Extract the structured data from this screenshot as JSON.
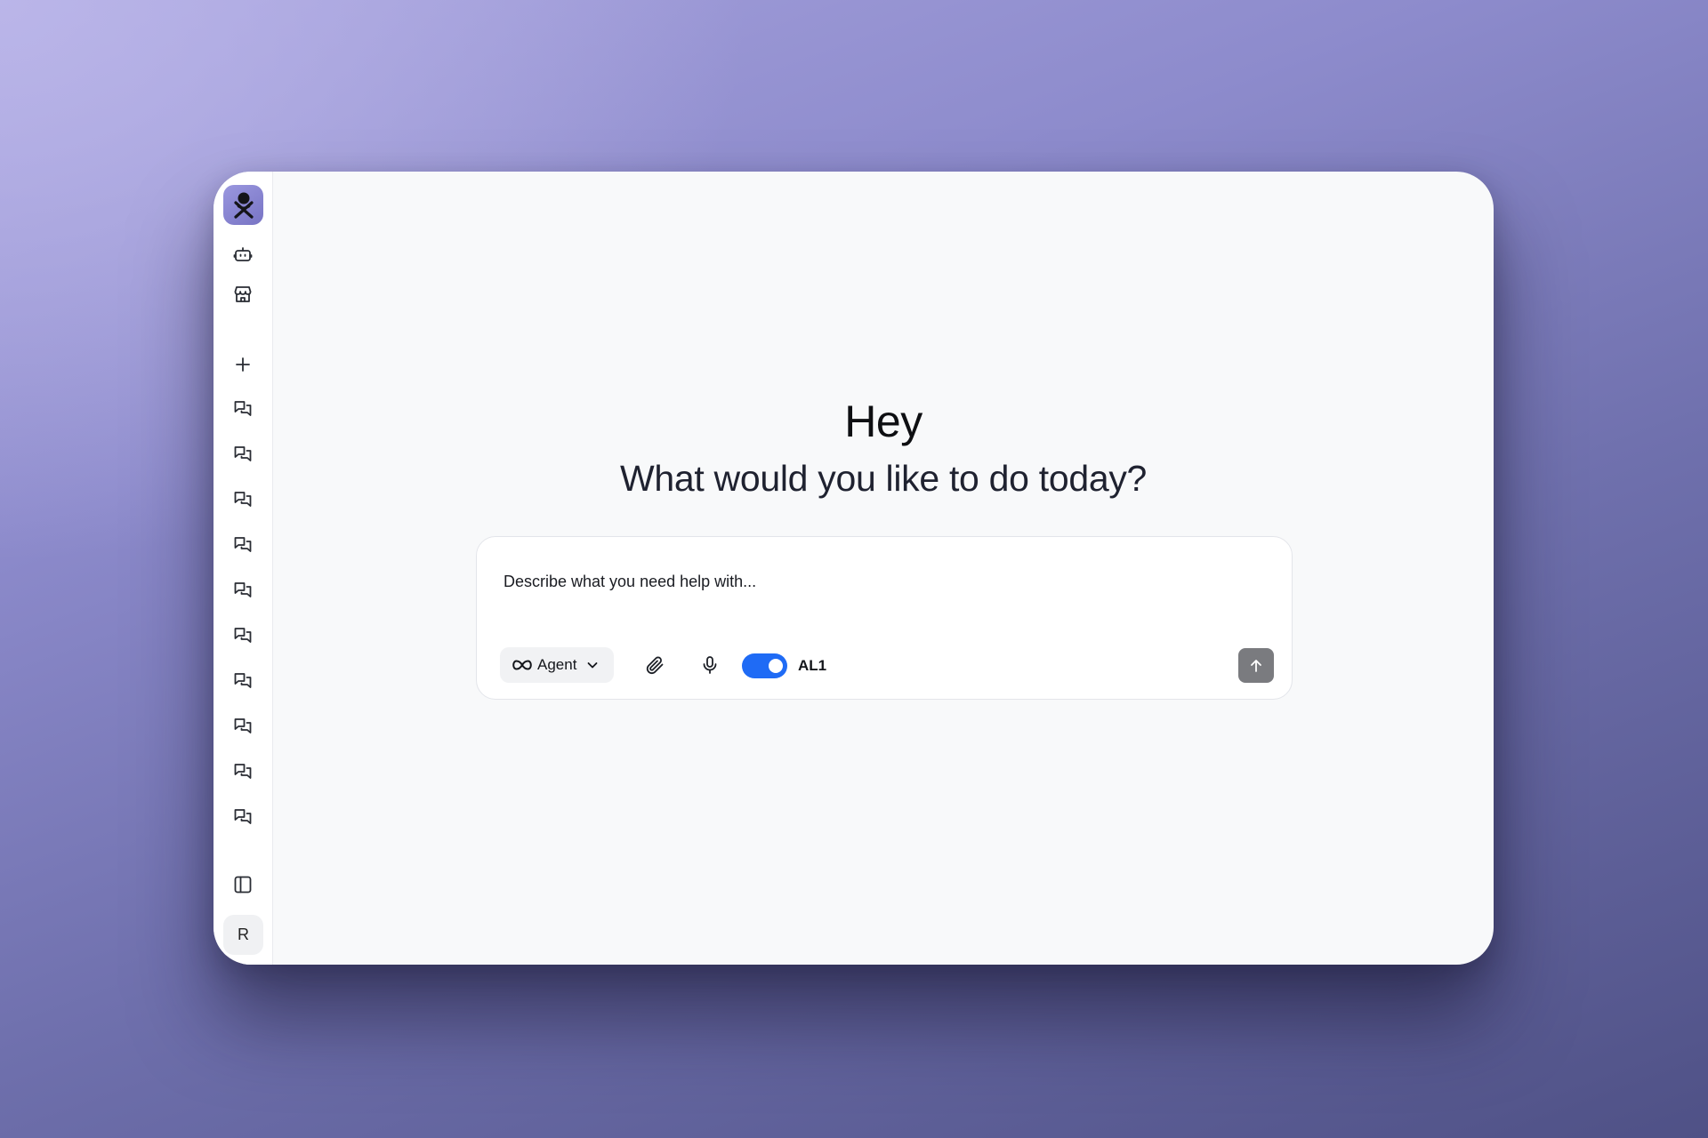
{
  "colors": {
    "background_start": "#a6a2dd",
    "background_end": "#4f5186",
    "window": "#f8f9fa",
    "toggle_on": "#1f6bf5",
    "send_button": "#7a7b7f",
    "logo": "#8884d2"
  },
  "sidebar": {
    "logo_icon": "agent-logo",
    "top_icons": [
      {
        "name": "agents",
        "icon": "robot-icon"
      },
      {
        "name": "store",
        "icon": "store-icon"
      }
    ],
    "new_chat_icon": "plus-icon",
    "chat_history_icon": "chat-bubbles-icon",
    "chat_history_count": 10,
    "toggle_sidebar_icon": "sidebar-panel-icon",
    "avatar_initial": "R"
  },
  "main": {
    "greeting": "Hey",
    "subtitle": "What would you like to do today?"
  },
  "composer": {
    "input_value": "",
    "placeholder": "Describe what you need help with...",
    "mode_icon": "infinity-icon",
    "mode_label": "Agent",
    "mode_chevron": "chevron-down-icon",
    "attach_icon": "paperclip-icon",
    "mic_icon": "microphone-icon",
    "toggle_on": true,
    "toggle_label": "AL1",
    "send_icon": "arrow-up-icon"
  }
}
